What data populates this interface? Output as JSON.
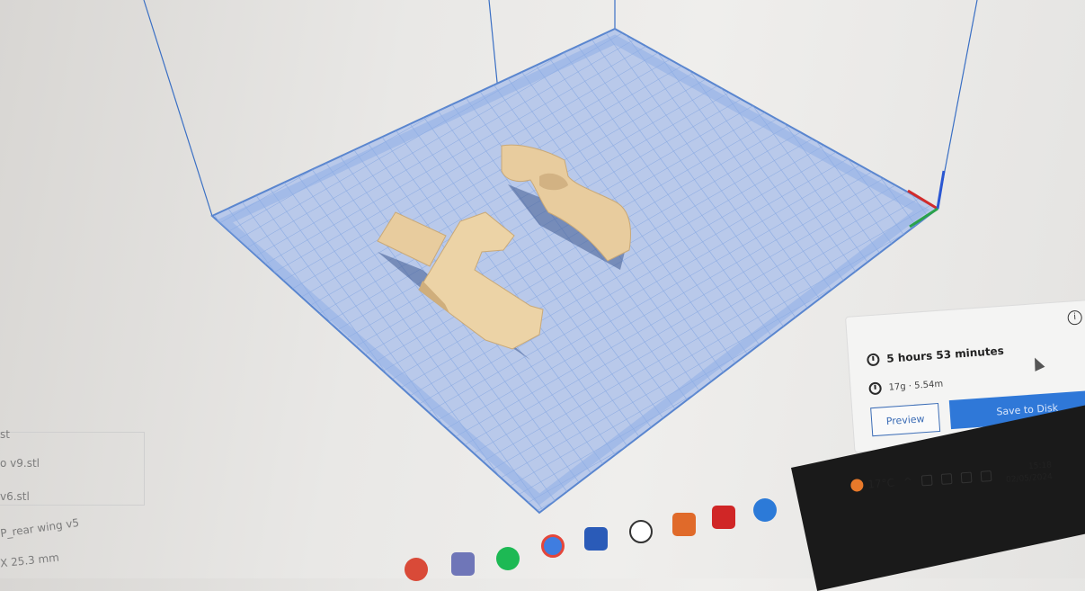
{
  "objects": {
    "header": "st",
    "items": [
      "o v9.stl",
      "v6.stl",
      "P_rear wing v5"
    ],
    "dimensions": "X 25.3 mm"
  },
  "estimate": {
    "print_time": "5 hours 53 minutes",
    "material": "17g · 5.54m",
    "info_icon": "info-icon",
    "preview_label": "Preview",
    "save_label": "Save to Disk"
  },
  "tray": {
    "temperature": "17°C",
    "time": "15:18",
    "date": "02/05/2024"
  },
  "taskbar_apps": [
    "chrome-icon",
    "files-icon",
    "spotify-icon",
    "chrome-icon",
    "word-icon",
    "whatsapp-icon",
    "office-icon",
    "acrobat-icon",
    "cura-icon"
  ],
  "colors": {
    "accent": "#2f78d8",
    "plate_grid": "#7ea2e0",
    "model": "#e8cc9e",
    "weather": "#e8792a"
  }
}
